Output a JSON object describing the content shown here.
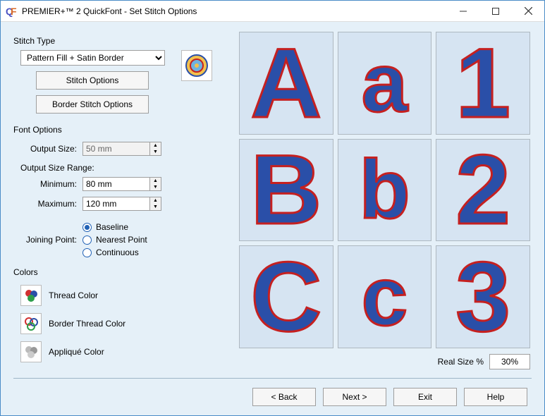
{
  "titlebar": {
    "title": "PREMIER+™ 2 QuickFont - Set Stitch Options"
  },
  "stitch": {
    "section": "Stitch Type",
    "combo_value": "Pattern Fill + Satin Border",
    "stitch_options": "Stitch Options",
    "border_stitch_options": "Border Stitch Options"
  },
  "font": {
    "section": "Font Options",
    "output_size_label": "Output Size:",
    "output_size_value": "50 mm",
    "range_label": "Output Size Range:",
    "min_label": "Minimum:",
    "min_value": "80 mm",
    "max_label": "Maximum:",
    "max_value": "120 mm",
    "joining_label": "Joining Point:",
    "join_baseline": "Baseline",
    "join_nearest": "Nearest Point",
    "join_continuous": "Continuous"
  },
  "colors": {
    "section": "Colors",
    "thread": "Thread Color",
    "border": "Border Thread Color",
    "applique": "Appliqué Color"
  },
  "preview": {
    "glyphs": [
      "A",
      "a",
      "1",
      "B",
      "b",
      "2",
      "C",
      "c",
      "3"
    ],
    "realsize_label": "Real Size %",
    "realsize_value": "30%"
  },
  "footer": {
    "back": "< Back",
    "next": "Next >",
    "exit": "Exit",
    "help": "Help"
  }
}
